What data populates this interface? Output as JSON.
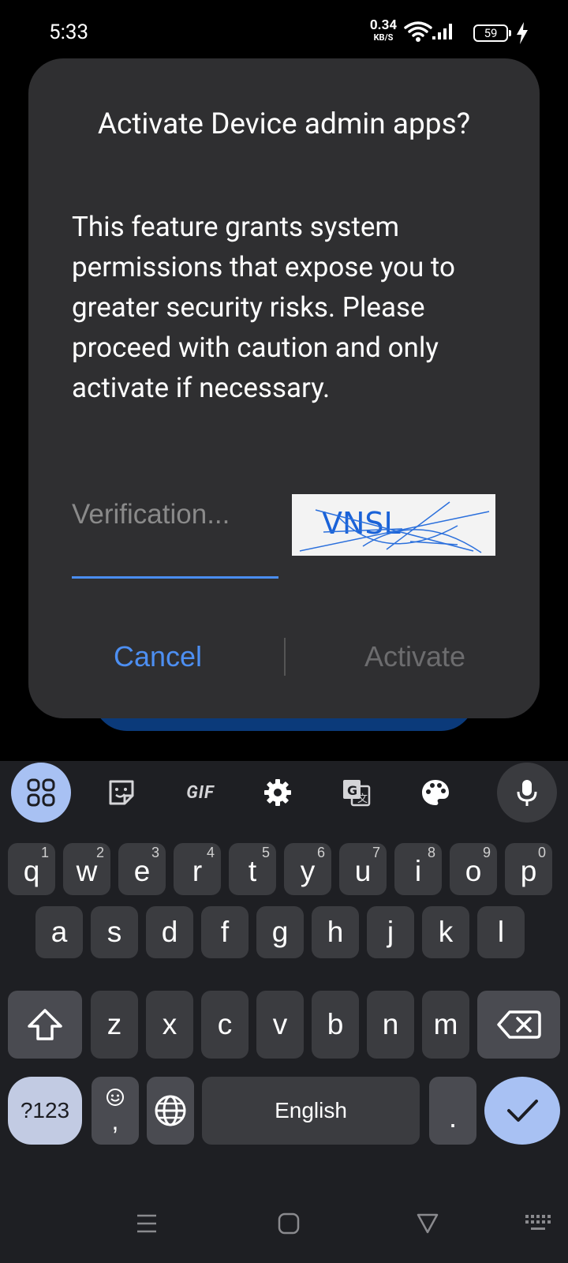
{
  "status_bar": {
    "time": "5:33",
    "net_speed_value": "0.34",
    "net_speed_unit": "KB/S",
    "battery_level": "59",
    "charging": true
  },
  "dialog": {
    "title": "Activate Device admin apps?",
    "message": "This feature grants system permissions that expose you to greater security risks. Please proceed with caution and only activate if necessary.",
    "verification_placeholder": "Verification...",
    "captcha_text": "VNSL",
    "cancel_label": "Cancel",
    "activate_label": "Activate"
  },
  "keyboard": {
    "toolbar": {
      "apps_icon": "grid-icon",
      "sticker_icon": "sticker-icon",
      "gif_label": "GIF",
      "settings_icon": "gear-icon",
      "translate_icon": "translate-icon",
      "theme_icon": "palette-icon",
      "voice_icon": "mic-icon"
    },
    "row1": [
      {
        "label": "q",
        "hint": "1"
      },
      {
        "label": "w",
        "hint": "2"
      },
      {
        "label": "e",
        "hint": "3"
      },
      {
        "label": "r",
        "hint": "4"
      },
      {
        "label": "t",
        "hint": "5"
      },
      {
        "label": "y",
        "hint": "6"
      },
      {
        "label": "u",
        "hint": "7"
      },
      {
        "label": "i",
        "hint": "8"
      },
      {
        "label": "o",
        "hint": "9"
      },
      {
        "label": "p",
        "hint": "0"
      }
    ],
    "row2": [
      "a",
      "s",
      "d",
      "f",
      "g",
      "h",
      "j",
      "k",
      "l"
    ],
    "row3": [
      "z",
      "x",
      "c",
      "v",
      "b",
      "n",
      "m"
    ],
    "bottom": {
      "symbols_label": "?123",
      "comma_label": ",",
      "space_label": "English",
      "period_label": "."
    }
  },
  "colors": {
    "accent": "#4d8ff2",
    "dialog_bg": "#2f2f31",
    "keyboard_bg": "#1e1f23",
    "key_bg": "#3b3c40"
  }
}
